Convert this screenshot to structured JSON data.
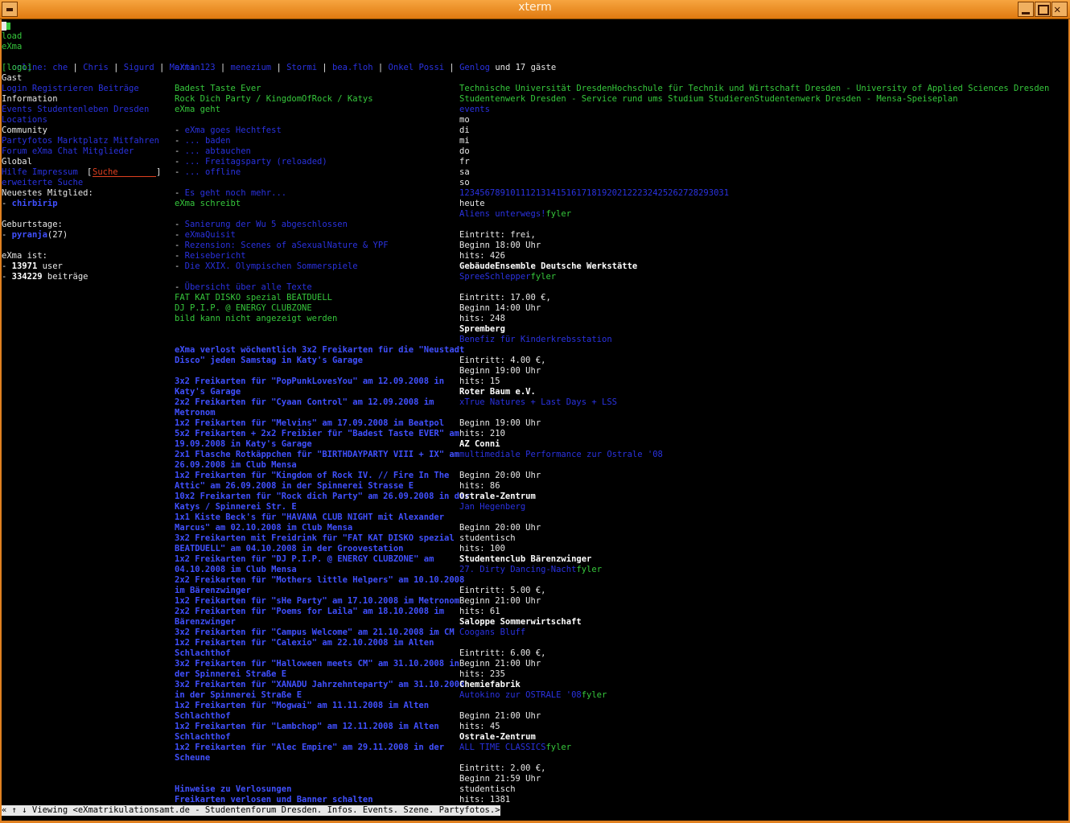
{
  "window": {
    "title": "xterm"
  },
  "top": {
    "load": "load",
    "exma": "eXma",
    "online_label": "online:",
    "online_users": [
      "che",
      "Chris",
      "Sigurd",
      "Martin123",
      "menezium",
      "Stormi",
      "bea.floh",
      "Onkel Possi",
      "Genlog"
    ],
    "online_suffix": "und 17 gäste"
  },
  "sidebar": {
    "logo": "[logo]",
    "gast": "Gast",
    "login_links": "Login Registrieren Beiträge",
    "information": "Information",
    "info_links": "Events Studentenleben Dresden",
    "locations": "Locations",
    "community": "Community",
    "community_links1": "Partyfotos Marktplatz Mitfahren",
    "community_links2": "Forum eXma Chat Mitglieder",
    "global": "Global",
    "global_links": "Hilfe Impressum",
    "search_lbracket": "[",
    "search_value": "Suche",
    "search_rbracket": "]",
    "extended_search": "erweiterte Suche",
    "newest_label": "Neuestes Mitglied:",
    "newest_dash": "- ",
    "newest_member": "chirbirip",
    "birthdays_label": "Geburtstage:",
    "birthday_dash": "- ",
    "birthday_name": "pyranja",
    "birthday_age": "(27)",
    "stats_label": "eXma ist:",
    "users_dash": "- ",
    "users_count": "13971",
    "users_text": " user",
    "posts_dash": "- ",
    "posts_count": "334229",
    "posts_text": " beiträge"
  },
  "middle": {
    "header": "eXma",
    "teasers": [
      "Badest Taste Ever",
      "Rock Dich Party / KingdomOfRock / Katys",
      "eXma geht"
    ],
    "exma_goes": [
      {
        "dash": "- ",
        "text": "eXma goes Hechtfest"
      },
      {
        "dash": "- ",
        "text": "... baden"
      },
      {
        "dash": "- ",
        "text": "... abtauchen"
      },
      {
        "dash": "- ",
        "text": "... Freitagsparty (reloaded)"
      },
      {
        "dash": "- ",
        "text": "... offline"
      }
    ],
    "more": {
      "dash": "- ",
      "text": "Es geht noch mehr..."
    },
    "schreibt": "eXma schreibt",
    "articles": [
      {
        "dash": "- ",
        "text": "Sanierung der Wu 5 abgeschlossen"
      },
      {
        "dash": "- ",
        "text": "eXmaQuisit"
      },
      {
        "dash": "- ",
        "text": "Rezension: Scenes of aSexualNature & YPF"
      },
      {
        "dash": "- ",
        "text": "Reisebericht"
      },
      {
        "dash": "- ",
        "text": "Die XXIX. Olympischen Sommerspiele"
      }
    ],
    "overview": {
      "dash": "- ",
      "text": "Übersicht über alle Texte"
    },
    "promo1": "FAT KAT DISKO spezial BEATDUELL",
    "promo2": "DJ P.I.P. @ ENERGY CLUBZONE",
    "img_alt": "bild kann nicht angezeigt werden",
    "raffle_lines": [
      "eXma verlost wöchentlich 3x2 Freikarten für die \"Neustadt",
      "Disco\" jeden Samstag in Katy's Garage",
      "",
      "3x2 Freikarten für \"PopPunkLovesYou\" am 12.09.2008 in",
      "Katy's Garage",
      "2x2 Freikarten für \"Cyaan Control\" am 12.09.2008 im",
      "Metronom",
      "1x2 Freikarten für \"Melvins\" am 17.09.2008 im Beatpol",
      "5x2 Freikarten + 2x2 Freibier für \"Badest Taste EVER\" am",
      "19.09.2008 in Katy's Garage",
      "2x1 Flasche Rotkäppchen für \"BIRTHDAYPARTY VIII + IX\" am",
      "26.09.2008 im Club Mensa",
      "1x2 Freikarten für \"Kingdom of Rock IV. // Fire In The",
      "Attic\" am 26.09.2008 in der Spinnerei Strasse E",
      "10x2 Freikarten für \"Rock dich Party\" am 26.09.2008 in der",
      "Katys / Spinnerei Str. E",
      "1x1 Kiste Beck's für \"HAVANA CLUB NIGHT mit Alexander",
      "Marcus\" am 02.10.2008 im Club Mensa",
      "3x2 Freikarten mit Freidrink für \"FAT KAT DISKO spezial",
      "BEATDUELL\" am 04.10.2008 in der Groovestation",
      "1x2 Freikarten für \"DJ P.I.P. @ ENERGY CLUBZONE\" am",
      "04.10.2008 im Club Mensa",
      "2x2 Freikarten für \"Mothers little Helpers\" am 10.10.2008",
      "im Bärenzwinger",
      "1x2 Freikarten für \"sHe Party\" am 17.10.2008 im Metronom",
      "2x2 Freikarten für \"Poems for Laila\" am 18.10.2008 im",
      "Bärenzwinger",
      "3x2 Freikarten für \"Campus Welcome\" am 21.10.2008 im CM",
      "1x2 Freikarten für \"Calexio\" am 22.10.2008 im Alten",
      "Schlachthof",
      "3x2 Freikarten für \"Halloween meets CM\" am 31.10.2008 in",
      "der Spinnerei Straße E",
      "3x2 Freikarten für \"XANADU Jahrzehnteparty\" am 31.10.2008",
      "in der Spinnerei Straße E",
      "1x2 Freikarten für \"Mogwai\" am 11.11.2008 im Alten",
      "Schlachthof",
      "1x2 Freikarten für \"Lambchop\" am 12.11.2008 im Alten",
      "Schlachthof",
      "1x2 Freikarten für \"Alec Empire\" am 29.11.2008 in der",
      "Scheune"
    ],
    "hints": "Hinweise zu Verlosungen",
    "banner": "Freikarten verlosen und Banner schalten"
  },
  "right": {
    "uni_links": "Technische Universität DresdenHochschule für Technik und Wirtschaft Dresden - University of Applied Sciences Dresden",
    "studentenwerk": "Studentenwerk Dresden - Service rund ums Studium StudierenStudentenwerk Dresden - Mensa-Speiseplan",
    "events": "events",
    "weekdays": [
      "mo",
      "di",
      "mi",
      "do",
      "fr",
      "sa",
      "so"
    ],
    "days": "12345678910111213141516171819202122232425262728293031",
    "heute": "heute",
    "event_rows": [
      {
        "c": "b",
        "text": "Aliens unterwegs!"
      },
      {
        "c": "g",
        "text": "fyler",
        "inline": true
      },
      {
        "c": "w",
        "text": ""
      },
      {
        "c": "w",
        "text": "Eintritt: frei,"
      },
      {
        "c": "w",
        "text": "Beginn 18:00 Uhr"
      },
      {
        "c": "w",
        "text": "hits: 426"
      },
      {
        "c": "W",
        "text": "GebäudeEnsemble Deutsche Werkstätte"
      },
      {
        "c": "b",
        "text": "SpreeSchlepper"
      },
      {
        "c": "g",
        "text": "fyler",
        "inline": true
      },
      {
        "c": "w",
        "text": ""
      },
      {
        "c": "w",
        "text": "Eintritt: 17.00 €,"
      },
      {
        "c": "w",
        "text": "Beginn 14:00 Uhr"
      },
      {
        "c": "w",
        "text": "hits: 248"
      },
      {
        "c": "W",
        "text": "Spremberg"
      },
      {
        "c": "b",
        "text": "Benefiz für Kinderkrebsstation"
      },
      {
        "c": "w",
        "text": ""
      },
      {
        "c": "w",
        "text": "Eintritt: 4.00 €,"
      },
      {
        "c": "w",
        "text": "Beginn 19:00 Uhr"
      },
      {
        "c": "w",
        "text": "hits: 15"
      },
      {
        "c": "W",
        "text": "Roter Baum e.V."
      },
      {
        "c": "b",
        "text": "xTrue Natures + Last Days + LSS"
      },
      {
        "c": "w",
        "text": ""
      },
      {
        "c": "w",
        "text": "Beginn 19:00 Uhr"
      },
      {
        "c": "w",
        "text": "hits: 210"
      },
      {
        "c": "W",
        "text": "AZ Conni"
      },
      {
        "c": "b",
        "text": "multimediale Performance zur Ostrale '08"
      },
      {
        "c": "w",
        "text": ""
      },
      {
        "c": "w",
        "text": "Beginn 20:00 Uhr"
      },
      {
        "c": "w",
        "text": "hits: 86"
      },
      {
        "c": "W",
        "text": "Ostrale-Zentrum"
      },
      {
        "c": "b",
        "text": "Jan Hegenberg"
      },
      {
        "c": "w",
        "text": ""
      },
      {
        "c": "w",
        "text": "Beginn 20:00 Uhr"
      },
      {
        "c": "w",
        "text": "studentisch"
      },
      {
        "c": "w",
        "text": "hits: 100"
      },
      {
        "c": "W",
        "text": "Studentenclub Bärenzwinger"
      },
      {
        "c": "b",
        "text": "27. Dirty Dancing-Nacht"
      },
      {
        "c": "g",
        "text": "fyler",
        "inline": true
      },
      {
        "c": "w",
        "text": ""
      },
      {
        "c": "w",
        "text": "Eintritt: 5.00 €,"
      },
      {
        "c": "w",
        "text": "Beginn 21:00 Uhr"
      },
      {
        "c": "w",
        "text": "hits: 61"
      },
      {
        "c": "W",
        "text": "Saloppe Sommerwirtschaft"
      },
      {
        "c": "b",
        "text": "Coogans Bluff"
      },
      {
        "c": "w",
        "text": ""
      },
      {
        "c": "w",
        "text": "Eintritt: 6.00 €,"
      },
      {
        "c": "w",
        "text": "Beginn 21:00 Uhr"
      },
      {
        "c": "w",
        "text": "hits: 235"
      },
      {
        "c": "W",
        "text": "Chemiefabrik"
      },
      {
        "c": "b",
        "text": "Autokino zur OSTRALE '08"
      },
      {
        "c": "g",
        "text": "fyler",
        "inline": true
      },
      {
        "c": "w",
        "text": ""
      },
      {
        "c": "w",
        "text": "Beginn 21:00 Uhr"
      },
      {
        "c": "w",
        "text": "hits: 45"
      },
      {
        "c": "W",
        "text": "Ostrale-Zentrum"
      },
      {
        "c": "b",
        "text": "ALL TIME CLASSICS"
      },
      {
        "c": "g",
        "text": "fyler",
        "inline": true
      },
      {
        "c": "w",
        "text": ""
      },
      {
        "c": "w",
        "text": "Eintritt: 2.00 €,"
      },
      {
        "c": "w",
        "text": "Beginn 21:59 Uhr"
      },
      {
        "c": "w",
        "text": "studentisch"
      },
      {
        "c": "w",
        "text": "hits: 1381"
      }
    ]
  },
  "statusbar": {
    "text": "« ↑ ↓ Viewing <eXmatrikulationsamt.de - Studentenforum Dresden. Infos. Events. Szene. Partyfotos.>"
  },
  "colors": {
    "green": "#36c83c",
    "blue": "#2a32e0",
    "white": "#e8e8e8",
    "titlebar": "#e08020"
  }
}
